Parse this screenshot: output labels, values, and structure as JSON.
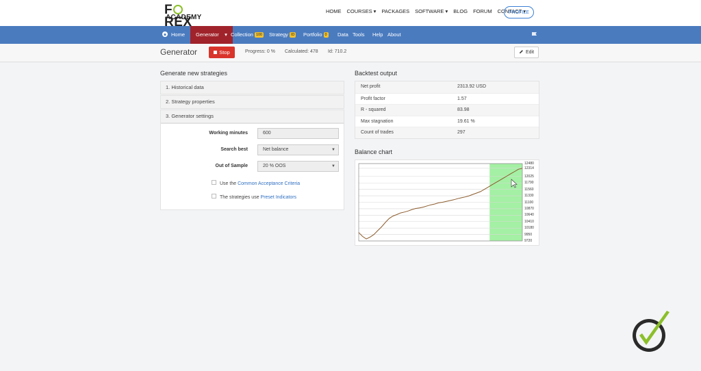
{
  "logo": {
    "line1_a": "F",
    "line1_b": "REX",
    "line2": "ACADEMY"
  },
  "topmenu": [
    "HOME",
    "COURSES ▾",
    "PACKAGES",
    "SOFTWARE ▾",
    "BLOG",
    "FORUM",
    "CONTACT ▾"
  ],
  "profile_label": "PROFILE",
  "bluebar": {
    "home": "Home",
    "generator": "Generator",
    "generator_caret": "▾",
    "collection": "Collection",
    "collection_count": "100",
    "strategy": "Strategy",
    "strategy_id": "ID",
    "portfolio": "Portfolio",
    "portfolio_count": "0",
    "data": "Data",
    "tools": "Tools",
    "help": "Help",
    "about": "About"
  },
  "subheader": {
    "title": "Generator",
    "stop_label": "Stop",
    "progress": "Progress: 0 %",
    "calculated": "Calculated: 478",
    "id": "Id: 710.2",
    "edit_label": "Edit"
  },
  "generate": {
    "title": "Generate new strategies",
    "sections": [
      "1. Historical data",
      "2. Strategy properties",
      "3. Generator settings"
    ],
    "working_minutes_label": "Working minutes",
    "working_minutes_value": "600",
    "search_best_label": "Search best",
    "search_best_value": "Net balance",
    "out_of_sample_label": "Out of Sample",
    "out_of_sample_value": "20 % OOS",
    "check1_prefix": "Use the ",
    "check1_link": "Common Acceptance Criteria",
    "check2_prefix": "The strategies use ",
    "check2_link": "Preset Indicators"
  },
  "backtest": {
    "title": "Backtest output",
    "rows": [
      {
        "k": "Net profit",
        "v": "2313.92 USD"
      },
      {
        "k": "Profit factor",
        "v": "1.57"
      },
      {
        "k": "R - squared",
        "v": "83.98"
      },
      {
        "k": "Max stagnation",
        "v": "19.61 %"
      },
      {
        "k": "Count of trades",
        "v": "297"
      }
    ]
  },
  "chart_data": {
    "type": "line",
    "title": "Balance chart",
    "y_ticks": [
      12480,
      12314,
      12025,
      11790,
      11560,
      11330,
      11100,
      10870,
      10640,
      10410,
      10180,
      9950,
      9720
    ],
    "ylim": [
      9720,
      12480
    ],
    "oos_fraction": 0.2,
    "series": [
      {
        "values": [
          10020,
          9880,
          9790,
          9860,
          9950,
          10090,
          10220,
          10380,
          10520,
          10610,
          10660,
          10720,
          10750,
          10790,
          10840,
          10880,
          10900,
          10930,
          10970,
          11010,
          11040,
          11080,
          11100,
          11130,
          11160,
          11190,
          11230,
          11260,
          11290,
          11330,
          11380,
          11430,
          11480,
          11560,
          11640,
          11720,
          11800,
          11880,
          11960,
          12040,
          12120,
          12200,
          12280,
          12314
        ]
      }
    ],
    "colors": {
      "line": "#8b5a2b",
      "oos": "#a4f0a4"
    }
  }
}
